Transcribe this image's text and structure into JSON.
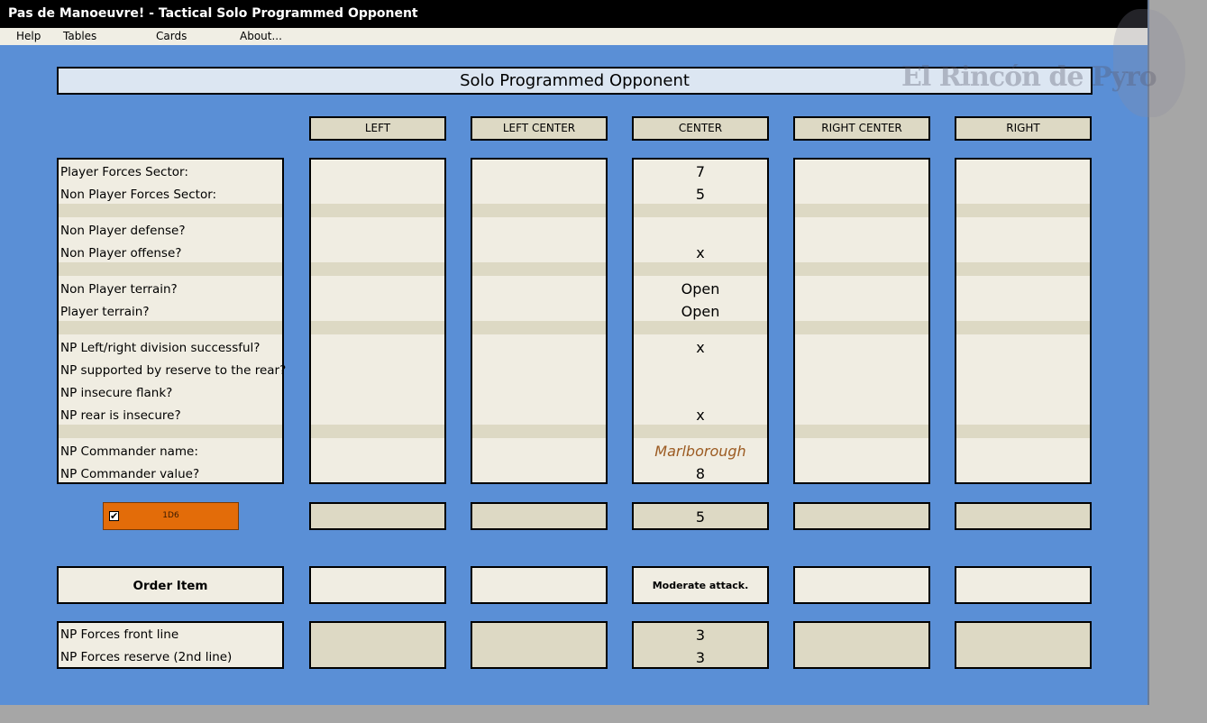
{
  "window": {
    "title": "Pas de Manoeuvre! - Tactical Solo Programmed Opponent"
  },
  "menu": [
    "Help",
    "Tables",
    "Cards",
    "About..."
  ],
  "watermark": "El Rincón de Pyro",
  "heading": "Solo Programmed Opponent",
  "columns": [
    "LEFT",
    "LEFT CENTER",
    "CENTER",
    "RIGHT CENTER",
    "RIGHT"
  ],
  "questions": {
    "player_forces_sector": "Player Forces Sector:",
    "non_player_forces_sector": "Non Player Forces Sector:",
    "np_defense": "Non Player defense?",
    "np_offense": "Non Player offense?",
    "np_terrain": "Non Player terrain?",
    "player_terrain": "Player terrain?",
    "np_division": "NP Left/right division successful?",
    "np_reserve": "NP supported by reserve to the rear?",
    "np_flank": "NP insecure flank?",
    "np_rear": "NP rear is insecure?",
    "np_commander_name": "NP Commander name:",
    "np_commander_value": "NP Commander value?"
  },
  "center": {
    "player_forces_sector": "7",
    "non_player_forces_sector": "5",
    "np_offense": "x",
    "np_terrain": "Open",
    "player_terrain": "Open",
    "np_division": "x",
    "np_rear": "x",
    "np_commander_name": "Marlborough",
    "np_commander_value": "8",
    "roll_result": "5",
    "order": "Moderate attack.",
    "front_line": "3",
    "reserve": "3"
  },
  "dice": {
    "label": "1D6",
    "checked": "✔"
  },
  "order_item_label": "Order Item",
  "forces": {
    "front_line_label": "NP Forces front line",
    "reserve_label": "NP Forces reserve (2nd line)"
  }
}
